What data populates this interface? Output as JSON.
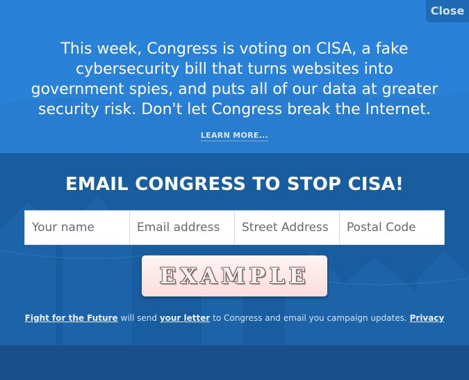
{
  "close_label": "Close",
  "headline": "This week, Congress is voting on CISA, a fake cybersecurity bill that turns websites into government spies, and puts all of our data at greater security risk. Don't let Congress break the Internet.",
  "learn_more": "LEARN MORE...",
  "cta": "EMAIL CONGRESS TO STOP CISA!",
  "form": {
    "name_placeholder": "Your name",
    "email_placeholder": "Email address",
    "street_placeholder": "Street Address",
    "postal_placeholder": "Postal Code"
  },
  "captcha_text": "EXAMPLE",
  "disclaimer": {
    "org_link": "Fight for the Future",
    "text1": " will send ",
    "letter_link": "your letter",
    "text2": " to Congress and email you campaign updates. ",
    "privacy_link": "Privacy"
  },
  "colors": {
    "top_bg": "#2a82d8",
    "bottom_bg": "#185d9f",
    "close_bg": "#1f6ab5"
  }
}
